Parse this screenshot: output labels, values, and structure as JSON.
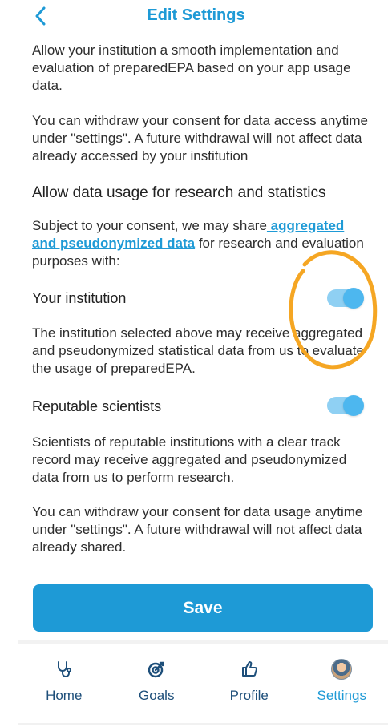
{
  "header": {
    "title": "Edit Settings",
    "back_icon": "chevron-left-icon"
  },
  "intro": {
    "p1": "Allow your institution a smooth implementation and evaluation of preparedEPA based on your app usage data.",
    "p2": "You can withdraw your consent for data access anytime under \"settings\". A future withdrawal will not affect data already accessed by your institution"
  },
  "research": {
    "heading": "Allow data usage for research and statistics",
    "text_before": "Subject to your consent, we may share",
    "link": " aggregated and pseudonymized data",
    "text_after": " for research and evaluation purposes with:"
  },
  "options": [
    {
      "title": "Your institution",
      "enabled": true,
      "description": "The institution selected above may receive aggregated and pseudonymized statistical data from us to evaluate the usage of preparedEPA."
    },
    {
      "title": "Reputable scientists",
      "enabled": true,
      "description": "Scientists of reputable institutions with a clear track record may receive aggregated and pseudonymized data from us to perform research."
    }
  ],
  "footer_note": "You can withdraw your consent for data usage anytime under \"settings\". A future withdrawal will not affect data already shared.",
  "save_label": "Save",
  "nav": [
    {
      "label": "Home",
      "icon": "stethoscope-icon",
      "active": false
    },
    {
      "label": "Goals",
      "icon": "target-icon",
      "active": false
    },
    {
      "label": "Profile",
      "icon": "thumbs-up-icon",
      "active": false
    },
    {
      "label": "Settings",
      "icon": "avatar-icon",
      "active": true
    }
  ],
  "colors": {
    "accent": "#1e9ad6",
    "annotation": "#f5a623",
    "nav_text": "#1e4f7a"
  }
}
